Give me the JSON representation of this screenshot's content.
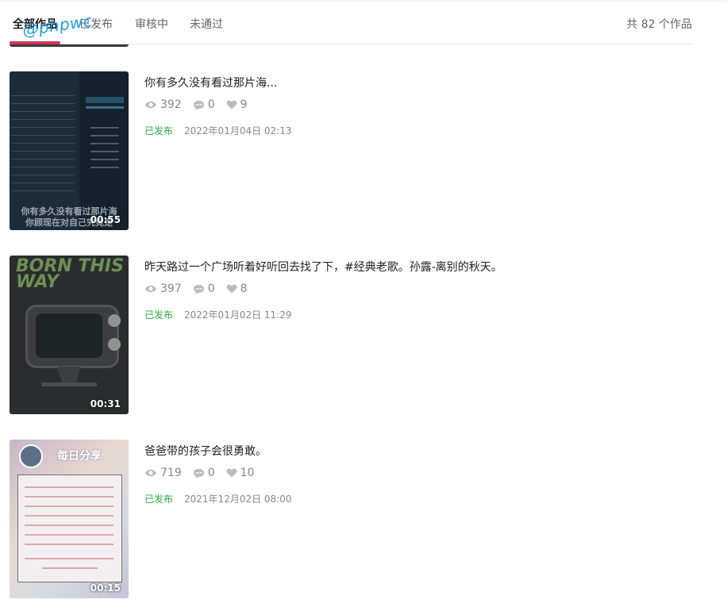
{
  "tabs": [
    {
      "label": "全部作品",
      "active": true
    },
    {
      "label": "已发布",
      "active": false
    },
    {
      "label": "审核中",
      "active": false
    },
    {
      "label": "未通过",
      "active": false
    }
  ],
  "count_label": "共 82 个作品",
  "watermark": "@phpwc",
  "accent_color": "#d0365a",
  "status_color": "#2eaa3f",
  "items": [
    {
      "title": "你有多久没有看过那片海...",
      "views": "392",
      "comments": "0",
      "likes": "9",
      "status": "已发布",
      "date": "2022年01月04日 02:13",
      "duration": "00:55",
      "thumb_caption_1": "你有多久没有看过那片海",
      "thumb_caption_2": "你顾现在对自己究竟是"
    },
    {
      "title": "昨天路过一个广场听着好听回去找了下，#经典老歌。孙露-离别的秋天。",
      "views": "397",
      "comments": "0",
      "likes": "8",
      "status": "已发布",
      "date": "2022年01月02日 11:29",
      "duration": "00:31",
      "thumb_text": "BORN THIS WAY"
    },
    {
      "title": "爸爸带的孩子会很勇敢。",
      "views": "719",
      "comments": "0",
      "likes": "10",
      "status": "已发布",
      "date": "2021年12月02日 08:00",
      "duration": "00:15",
      "thumb_banner": "每日分享"
    }
  ]
}
